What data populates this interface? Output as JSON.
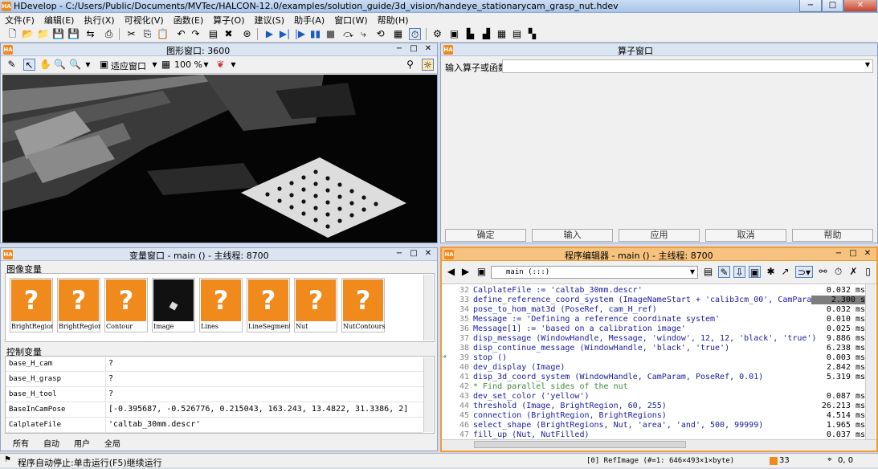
{
  "app": {
    "title": "HDevelop - C:/Users/Public/Documents/MVTec/HALCON-12.0/examples/solution_guide/3d_vision/handeye_stationarycam_grasp_nut.hdev",
    "logo": "HA"
  },
  "window_controls": {
    "minimize": "−",
    "maximize": "□",
    "close": "✕"
  },
  "menu": [
    "文件(F)",
    "编辑(E)",
    "执行(X)",
    "可视化(V)",
    "函数(E)",
    "算子(O)",
    "建议(S)",
    "助手(A)",
    "窗口(W)",
    "帮助(H)"
  ],
  "graphics_window": {
    "title": "图形窗口: 3600",
    "fit_label": "适应窗口",
    "zoom": "100 %"
  },
  "operator_window": {
    "title": "算子窗口",
    "input_label": "输入算子或函数",
    "buttons": [
      "确定",
      "输入",
      "应用",
      "取消",
      "帮助"
    ]
  },
  "variable_window": {
    "title": "变量窗口 - main () - 主线程: 8700",
    "image_vars_label": "图像变量",
    "images": [
      {
        "name": "BrightRegion",
        "icon": "question-icon"
      },
      {
        "name": "BrightRegions",
        "icon": "question-icon"
      },
      {
        "name": "Contour",
        "icon": "question-icon"
      },
      {
        "name": "Image",
        "icon": "image-preview"
      },
      {
        "name": "Lines",
        "icon": "question-icon"
      },
      {
        "name": "LineSegments",
        "icon": "question-icon"
      },
      {
        "name": "Nut",
        "icon": "question-icon"
      },
      {
        "name": "NutContours",
        "icon": "question-icon"
      }
    ],
    "control_vars_label": "控制变量",
    "controls": [
      {
        "name": "base_H_cam",
        "value": "?"
      },
      {
        "name": "base_H_grasp",
        "value": "?"
      },
      {
        "name": "base_H_tool",
        "value": "?"
      },
      {
        "name": "BaseInCamPose",
        "value": "[-0.395687, -0.526776, 0.215043, 163.243, 13.4822, 31.3386, 2]"
      },
      {
        "name": "CalplateFile",
        "value": "'caltab_30mm.descr'"
      }
    ],
    "tabs": [
      "所有",
      "自动",
      "用户",
      "全局"
    ]
  },
  "program_editor": {
    "title": "程序编辑器 - main () - 主线程: 8700",
    "procedure": "main (:::)",
    "lines": [
      {
        "num": "32",
        "code": "CalplateFile := 'caltab_30mm.descr'",
        "time": "0.032 ms",
        "type": "code"
      },
      {
        "num": "33",
        "code": "define_reference_coord_system (ImageNameStart + 'calib3cm_00', CamParam, Ca",
        "time": "2.300  s",
        "type": "code"
      },
      {
        "num": "34",
        "code": "pose_to_hom_mat3d (PoseRef, cam_H_ref)",
        "time": "0.032 ms",
        "type": "code"
      },
      {
        "num": "35",
        "code": "Message := 'Defining a reference coordinate system'",
        "time": "0.010 ms",
        "type": "code"
      },
      {
        "num": "36",
        "code": "Message[1] := 'based on a calibration image'",
        "time": "0.025 ms",
        "type": "code"
      },
      {
        "num": "37",
        "code": "disp_message (WindowHandle, Message, 'window', 12, 12, 'black', 'true')",
        "time": "9.886 ms",
        "type": "code"
      },
      {
        "num": "38",
        "code": "disp_continue_message (WindowHandle, 'black', 'true')",
        "time": "6.238 ms",
        "type": "code"
      },
      {
        "num": "39",
        "code": "stop ()",
        "time": "0.003 ms",
        "type": "code"
      },
      {
        "num": "40",
        "code": "dev_display (Image)",
        "time": "2.842 ms",
        "type": "code"
      },
      {
        "num": "41",
        "code": "disp_3d_coord_system (WindowHandle, CamParam, PoseRef, 0.01)",
        "time": "5.319 ms",
        "type": "code"
      },
      {
        "num": "42",
        "code": "* Find parallel sides of the nut",
        "time": "",
        "type": "comment"
      },
      {
        "num": "43",
        "code": "dev_set_color ('yellow')",
        "time": "0.087 ms",
        "type": "code"
      },
      {
        "num": "44",
        "code": "threshold (Image, BrightRegion, 60, 255)",
        "time": "26.213 ms",
        "type": "code"
      },
      {
        "num": "45",
        "code": "connection (BrightRegion, BrightRegions)",
        "time": "4.514 ms",
        "type": "code"
      },
      {
        "num": "46",
        "code": "select_shape (BrightRegions, Nut, 'area', 'and', 500, 99999)",
        "time": "1.965 ms",
        "type": "code"
      },
      {
        "num": "47",
        "code": "fill_up (Nut, NutFilled)",
        "time": "0.037 ms",
        "type": "code"
      }
    ]
  },
  "status": {
    "message": "程序自动停止:单击运行(F5)继续运行",
    "image_info": "[0] RefImage (#=1: 646×493×1×byte)",
    "count": "33",
    "coords": "0, 0"
  },
  "colors": {
    "accent": "#f08a1c",
    "titlebar": "#a9c4e8",
    "active_panel": "#f09a3a"
  }
}
